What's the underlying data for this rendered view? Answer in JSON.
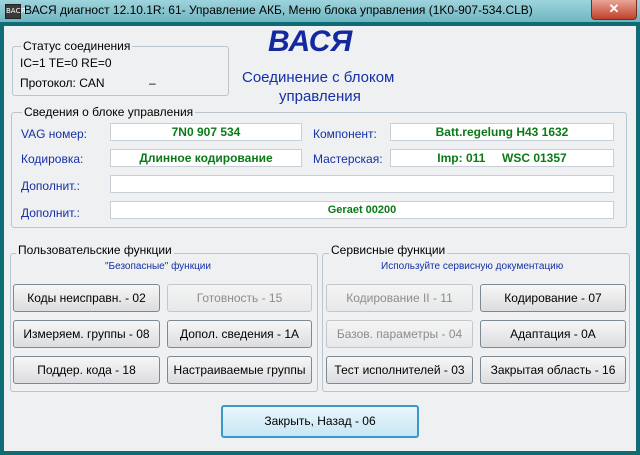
{
  "window": {
    "icon_text": "ВАСЯ",
    "title": "ВАСЯ диагност 12.10.1R: 61- Управление АКБ,  Меню блока управления (1K0-907-534.CLB)",
    "close_glyph": "✕"
  },
  "connection": {
    "group_label": "Статус соединения",
    "counters": "IC=1  TE=0  RE=0",
    "protocol": "Протокол: CAN",
    "protocol_extra": "–"
  },
  "branding": {
    "logo": "ВАСЯ",
    "subtitle_line1": "Соединение с блоком",
    "subtitle_line2": "управления"
  },
  "controller_info": {
    "group_label": "Сведения о блоке управления",
    "vag_label": "VAG номер:",
    "vag_value": "7N0 907 534",
    "component_label": "Компонент:",
    "component_value": "Batt.regelung H43 1632",
    "coding_label": "Кодировка:",
    "coding_value": "Длинное кодирование",
    "workshop_label": "Мастерская:",
    "workshop_value": "Imp: 011     WSC 01357",
    "extra1_label": "Дополнит.:",
    "extra1_value": "",
    "extra2_label": "Дополнит.:",
    "extra2_value": "Geraet 00200"
  },
  "user_functions": {
    "group_label": "Пользовательские функции",
    "note": "\"Безопасные\" функции",
    "buttons": [
      "Коды неисправн. - 02",
      "Готовность - 15",
      "Измеряем. группы - 08",
      "Допол. сведения - 1А",
      "Поддер. кода - 18",
      "Настраиваемые группы"
    ]
  },
  "service_functions": {
    "group_label": "Сервисные функции",
    "note": "Используйте сервисную документацию",
    "buttons": [
      "Кодирование II - 11",
      "Кодирование - 07",
      "Базов. параметры - 04",
      "Адаптация - 0А",
      "Тест исполнителей - 03",
      "Закрытая область - 16"
    ]
  },
  "footer": {
    "close_button": "Закрыть, Назад - 06"
  },
  "colors": {
    "accent_blue": "#1530a8",
    "value_green": "#0a7a18",
    "logo_blue": "#1428a0",
    "window_frame": "#0e6c74"
  }
}
